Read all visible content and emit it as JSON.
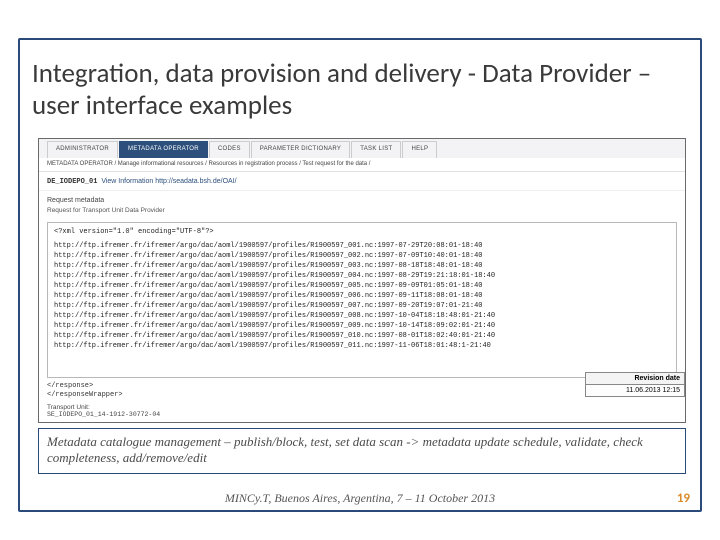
{
  "title": "Integration, data provision and delivery - Data Provider – user interface examples",
  "nav": {
    "tabs": [
      "ADMINISTRATOR",
      "METADATA OPERATOR",
      "CODES",
      "PARAMETER DICTIONARY",
      "TASK LIST",
      "HELP"
    ],
    "active_index": 1
  },
  "breadcrumb": "METADATA OPERATOR / Manage informational resources / Resources in registration process / Test request for the data /",
  "tu": {
    "id": "DE_IODEPO_01",
    "link": "View Information http://seadata.bsh.de/OAI/"
  },
  "section": {
    "header": "Request metadata",
    "sub": "Request for Transport Unit Data Provider"
  },
  "xml": {
    "header": "<?xml version=\"1.0\" encoding=\"UTF-8\"?>",
    "lines": [
      "http://ftp.ifremer.fr/ifremer/argo/dac/aoml/1900597/profiles/R1900597_001.nc:1997-07-29T20:08:01-18:40",
      "http://ftp.ifremer.fr/ifremer/argo/dac/aoml/1900597/profiles/R1900597_002.nc:1997-07-09T10:40:01-18:40",
      "http://ftp.ifremer.fr/ifremer/argo/dac/aoml/1900597/profiles/R1900597_003.nc:1997-08-18T18:48:01-18:40",
      "http://ftp.ifremer.fr/ifremer/argo/dac/aoml/1900597/profiles/R1900597_004.nc:1997-08-29T19:21:18:01-18:40",
      "http://ftp.ifremer.fr/ifremer/argo/dac/aoml/1900597/profiles/R1900597_005.nc:1997-09-09T01:05:01-18:40",
      "http://ftp.ifremer.fr/ifremer/argo/dac/aoml/1900597/profiles/R1900597_006.nc:1997-09-11T18:08:01-18:40",
      "http://ftp.ifremer.fr/ifremer/argo/dac/aoml/1900597/profiles/R1900597_007.nc:1997-09-20T19:07:01-21:40",
      "http://ftp.ifremer.fr/ifremer/argo/dac/aoml/1900597/profiles/R1900597_008.nc:1997-10-04T18:18:48:01-21:40",
      "http://ftp.ifremer.fr/ifremer/argo/dac/aoml/1900597/profiles/R1900597_009.nc:1997-10-14T18:09:02:01-21:40",
      "http://ftp.ifremer.fr/ifremer/argo/dac/aoml/1900597/profiles/R1900597_010.nc:1997-08-01T18:02:40:01-21:40",
      "http://ftp.ifremer.fr/ifremer/argo/dac/aoml/1900597/profiles/R1900597_011.nc:1997-11-06T18:01:48:1-21:40"
    ]
  },
  "closing": [
    "</response>",
    "</responseWrapper>"
  ],
  "tu_footer": {
    "label": "Transport Unit:",
    "value": "SE_IODEPO_01_14-1912-30772-04"
  },
  "revision": {
    "header": "Revision date",
    "value": "11.06.2013 12:15"
  },
  "caption": "Metadata catalogue management – publish/block, test, set data scan -> metadata update schedule, validate, check completeness, add/remove/edit",
  "footer": "MINCy.T, Buenos Aires, Argentina, 7 – 11 October 2013",
  "page_number": "19"
}
